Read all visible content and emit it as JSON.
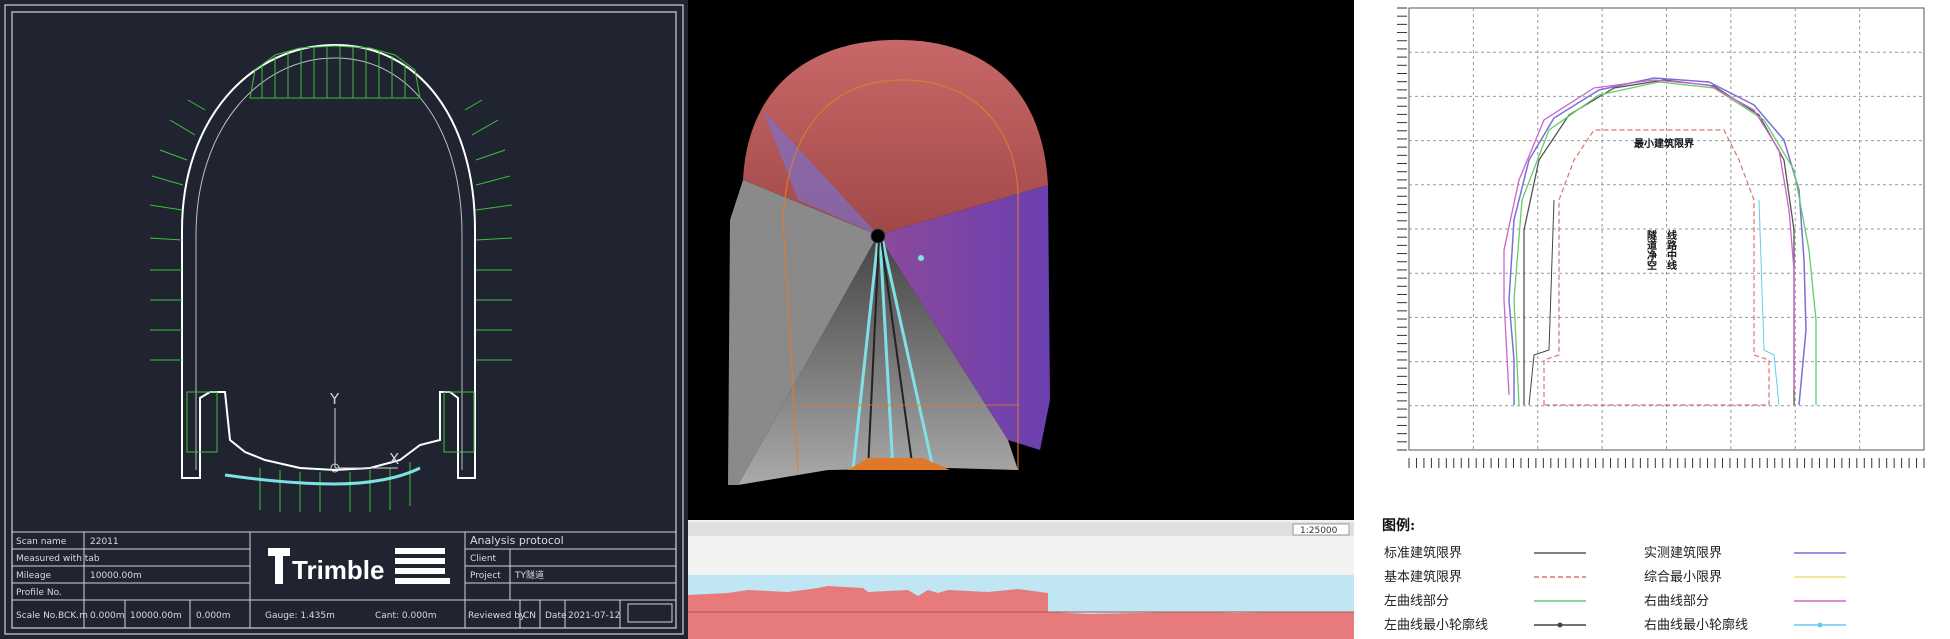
{
  "cad_panel": {
    "axis_y": "Y",
    "axis_x": "X",
    "logo_text": "Trimble",
    "title_block": {
      "left_rows": [
        {
          "label": "Scan name",
          "value": "22011"
        },
        {
          "label": "Measured with tab",
          "value": ""
        },
        {
          "label": "Mileage",
          "value": "10000.00m"
        },
        {
          "label": "Profile No.",
          "value": ""
        }
      ],
      "bottom_left": [
        "Scale No.BCK.m",
        "0.000m",
        "10000.00m",
        "0.000m"
      ],
      "gauge_label": "Gauge: 1.435m",
      "cant_label": "Cant: 0.000m",
      "right_title": "Analysis protocol",
      "right_rows": [
        {
          "label": "Client",
          "value": ""
        },
        {
          "label": "Project",
          "value": "TY隧道"
        }
      ],
      "reviewed": [
        "Reviewed by",
        "CN",
        "Date",
        "2021-07-12"
      ]
    }
  },
  "scan_panel": {
    "window_label": "1:25000"
  },
  "clearance_panel": {
    "center_label": "最小建筑限界",
    "vertical_labels": [
      "隧道净空",
      "线路中线"
    ],
    "legend_title": "图例:",
    "legend": [
      {
        "label": "标准建筑限界",
        "color": "#555555",
        "style": "solid"
      },
      {
        "label": "实测建筑限界",
        "color": "#7b6fd9",
        "style": "solid"
      },
      {
        "label": "基本建筑限界",
        "color": "#e07070",
        "style": "dashed"
      },
      {
        "label": "综合最小限界",
        "color": "#e8e070",
        "style": "solid"
      },
      {
        "label": "左曲线部分",
        "color": "#66cc66",
        "style": "solid"
      },
      {
        "label": "右曲线部分",
        "color": "#cc66cc",
        "style": "solid"
      },
      {
        "label": "左曲线最小轮廓线",
        "color": "#444444",
        "style": "dot"
      },
      {
        "label": "右曲线最小轮廓线",
        "color": "#66ccee",
        "style": "dot"
      }
    ]
  }
}
